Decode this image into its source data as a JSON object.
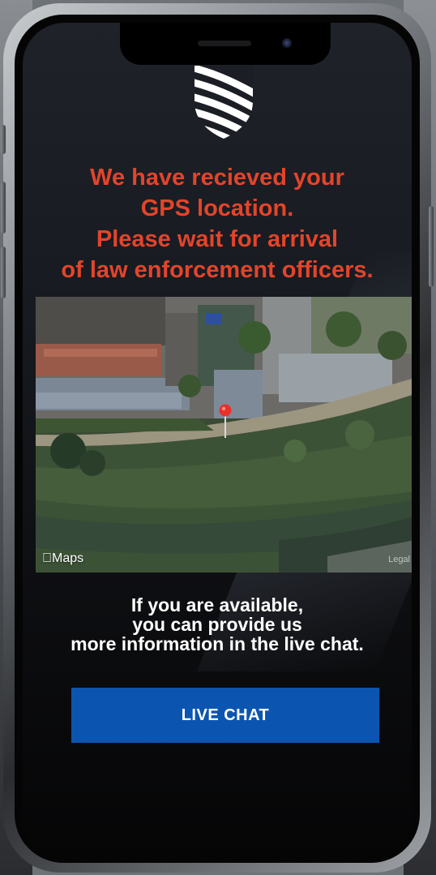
{
  "app": {
    "brand_logo_icon": "striped-shield-icon"
  },
  "alert": {
    "headline_lines": [
      "We have recieved your",
      "GPS location.",
      "Please wait for arrival",
      "of law enforcement officers."
    ],
    "color": "#e2452b"
  },
  "map": {
    "provider_label": "Maps",
    "provider_icon": "apple-logo-icon",
    "legal_label": "Legal",
    "pin_icon": "map-pin-icon"
  },
  "info": {
    "lines": [
      "If you are available,",
      "you can provide us",
      "more information in the live chat."
    ]
  },
  "actions": {
    "live_chat_label": "LIVE CHAT",
    "button_color": "#0b55b0"
  }
}
